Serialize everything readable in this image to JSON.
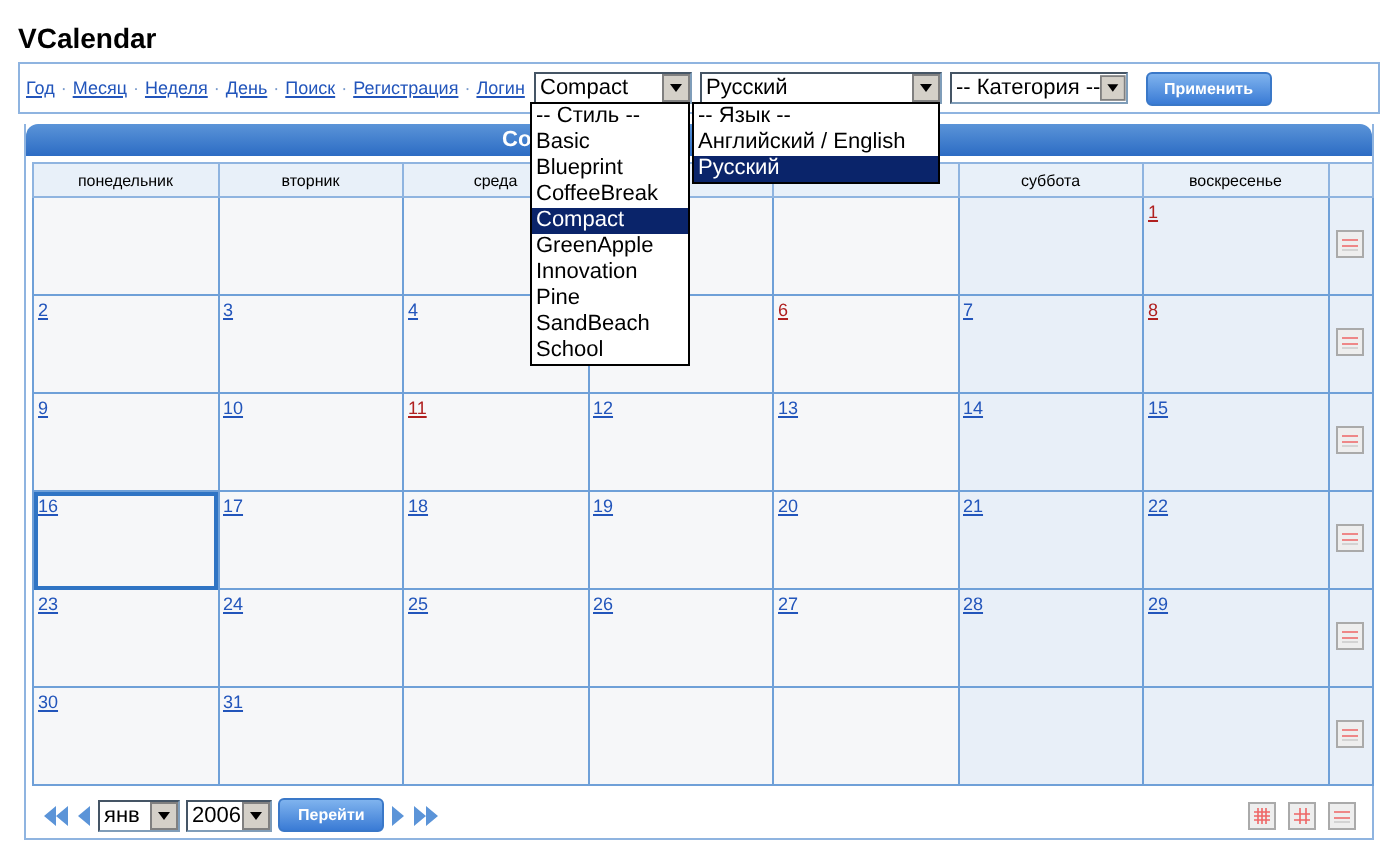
{
  "app_title": "VCalendar",
  "nav_links": [
    {
      "label": "Год",
      "separator": "·"
    },
    {
      "label": "Месяц",
      "separator": "·"
    },
    {
      "label": "Неделя",
      "separator": "·"
    },
    {
      "label": "День",
      "separator": "·"
    },
    {
      "label": "Поиск",
      "separator": "·"
    },
    {
      "label": "Регистрация",
      "separator": "·"
    },
    {
      "label": "Логин"
    }
  ],
  "style_select": {
    "value": "Compact",
    "open": true,
    "options": [
      {
        "label": "-- Стиль --",
        "selected": false
      },
      {
        "label": "Basic",
        "selected": false
      },
      {
        "label": "Blueprint",
        "selected": false
      },
      {
        "label": "CoffeeBreak",
        "selected": false
      },
      {
        "label": "Compact",
        "selected": true
      },
      {
        "label": "GreenApple",
        "selected": false
      },
      {
        "label": "Innovation",
        "selected": false
      },
      {
        "label": "Pine",
        "selected": false
      },
      {
        "label": "SandBeach",
        "selected": false
      },
      {
        "label": "School",
        "selected": false
      }
    ]
  },
  "language_select": {
    "value": "Русский",
    "open": true,
    "options": [
      {
        "label": "-- Язык --",
        "selected": false
      },
      {
        "label": "Английский / English",
        "selected": false
      },
      {
        "label": "Русский",
        "selected": true
      }
    ]
  },
  "category_select": {
    "value": "-- Категория --"
  },
  "apply_button": "Применить",
  "calendar": {
    "title": "Со",
    "weekdays": [
      {
        "kind": "shown",
        "label": "понедельник"
      },
      {
        "kind": "shown",
        "label": "вторник"
      },
      {
        "kind": "shown",
        "label": "среда"
      },
      {
        "kind": "covered"
      },
      {
        "kind": "covered"
      },
      {
        "kind": "shown",
        "label": "суббота"
      },
      {
        "kind": "shown",
        "label": "воскресенье"
      }
    ],
    "weeks": [
      {
        "days": [
          {
            "kind": "empty"
          },
          {
            "kind": "empty"
          },
          {
            "kind": "empty"
          },
          {
            "kind": "empty"
          },
          {
            "kind": "empty"
          },
          {
            "kind": "empty"
          },
          {
            "kind": "day",
            "number": "1",
            "holiday": true,
            "today": false
          }
        ]
      },
      {
        "days": [
          {
            "kind": "day",
            "number": "2",
            "holiday": false,
            "today": false
          },
          {
            "kind": "day",
            "number": "3",
            "holiday": false,
            "today": false
          },
          {
            "kind": "day",
            "number": "4",
            "holiday": false,
            "today": false
          },
          {
            "kind": "covered"
          },
          {
            "kind": "day",
            "number": "6",
            "holiday": true,
            "today": false
          },
          {
            "kind": "day",
            "number": "7",
            "holiday": false,
            "today": false
          },
          {
            "kind": "day",
            "number": "8",
            "holiday": true,
            "today": false
          }
        ]
      },
      {
        "days": [
          {
            "kind": "day",
            "number": "9",
            "holiday": false,
            "today": false
          },
          {
            "kind": "day",
            "number": "10",
            "holiday": false,
            "today": false
          },
          {
            "kind": "day",
            "number": "11",
            "holiday": true,
            "today": false
          },
          {
            "kind": "day",
            "number": "12",
            "holiday": false,
            "today": false
          },
          {
            "kind": "day",
            "number": "13",
            "holiday": false,
            "today": false
          },
          {
            "kind": "day",
            "number": "14",
            "holiday": false,
            "today": false
          },
          {
            "kind": "day",
            "number": "15",
            "holiday": false,
            "today": false
          }
        ]
      },
      {
        "days": [
          {
            "kind": "day",
            "number": "16",
            "holiday": false,
            "today": true
          },
          {
            "kind": "day",
            "number": "17",
            "holiday": false,
            "today": false
          },
          {
            "kind": "day",
            "number": "18",
            "holiday": false,
            "today": false
          },
          {
            "kind": "day",
            "number": "19",
            "holiday": false,
            "today": false
          },
          {
            "kind": "day",
            "number": "20",
            "holiday": false,
            "today": false
          },
          {
            "kind": "day",
            "number": "21",
            "holiday": false,
            "today": false
          },
          {
            "kind": "day",
            "number": "22",
            "holiday": false,
            "today": false
          }
        ]
      },
      {
        "days": [
          {
            "kind": "day",
            "number": "23",
            "holiday": false,
            "today": false
          },
          {
            "kind": "day",
            "number": "24",
            "holiday": false,
            "today": false
          },
          {
            "kind": "day",
            "number": "25",
            "holiday": false,
            "today": false
          },
          {
            "kind": "day",
            "number": "26",
            "holiday": false,
            "today": false
          },
          {
            "kind": "day",
            "number": "27",
            "holiday": false,
            "today": false
          },
          {
            "kind": "day",
            "number": "28",
            "holiday": false,
            "today": false
          },
          {
            "kind": "day",
            "number": "29",
            "holiday": false,
            "today": false
          }
        ]
      },
      {
        "days": [
          {
            "kind": "day",
            "number": "30",
            "holiday": false,
            "today": false
          },
          {
            "kind": "day",
            "number": "31",
            "holiday": false,
            "today": false
          },
          {
            "kind": "empty"
          },
          {
            "kind": "empty"
          },
          {
            "kind": "empty"
          },
          {
            "kind": "empty"
          },
          {
            "kind": "empty"
          }
        ]
      }
    ]
  },
  "footer": {
    "month_select": {
      "value": "янв"
    },
    "year_select": {
      "value": "2006"
    },
    "go_button": "Перейти"
  }
}
